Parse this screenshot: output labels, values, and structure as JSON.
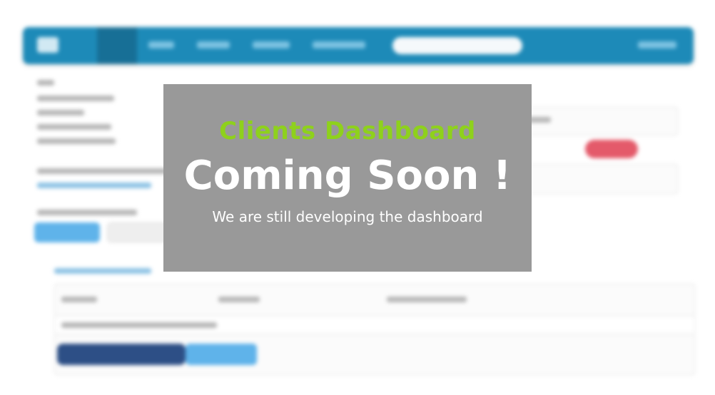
{
  "overlay": {
    "subtitle": "Clients Dashboard",
    "title": "Coming Soon !",
    "message": "We are still developing the dashboard"
  },
  "colors": {
    "overlay_bg": "#999999",
    "subtitle": "#8ed11c",
    "navbar": "#1d8ab8"
  }
}
